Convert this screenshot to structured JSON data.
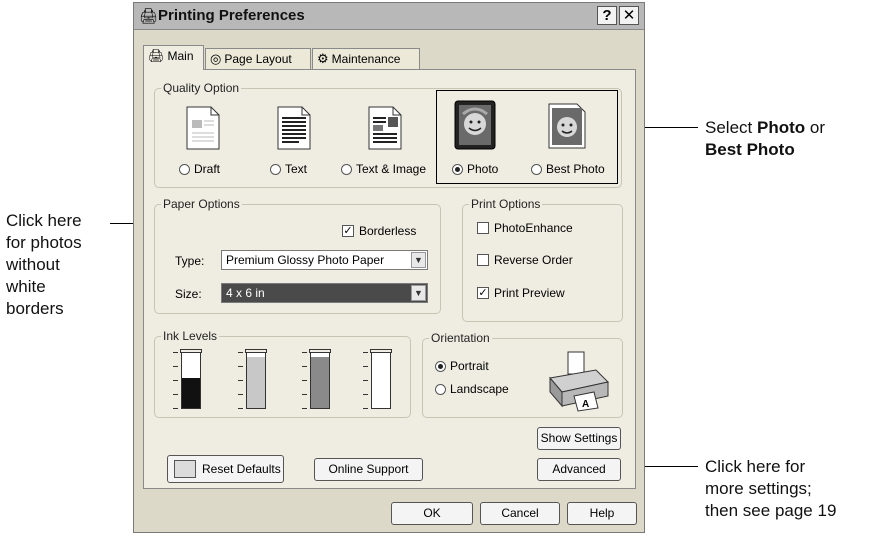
{
  "window": {
    "title": "Printing Preferences",
    "help_btn": "?",
    "close_btn": "✕"
  },
  "tabs": [
    {
      "label": "Main",
      "icon": "printer-icon"
    },
    {
      "label": "Page Layout",
      "icon": "page-layout-icon"
    },
    {
      "label": "Maintenance",
      "icon": "maintenance-icon"
    }
  ],
  "quality": {
    "group_label": "Quality Option",
    "options": [
      {
        "label": "Draft",
        "selected": false
      },
      {
        "label": "Text",
        "selected": false
      },
      {
        "label": "Text & Image",
        "selected": false
      },
      {
        "label": "Photo",
        "selected": true
      },
      {
        "label": "Best Photo",
        "selected": false
      }
    ]
  },
  "paper": {
    "group_label": "Paper Options",
    "borderless_label": "Borderless",
    "borderless_checked": true,
    "type_label": "Type:",
    "type_value": "Premium Glossy Photo Paper",
    "size_label": "Size:",
    "size_value": "4 x 6 in"
  },
  "print_options": {
    "group_label": "Print Options",
    "items": [
      {
        "label": "PhotoEnhance",
        "checked": false
      },
      {
        "label": "Reverse Order",
        "checked": false
      },
      {
        "label": "Print Preview",
        "checked": true
      }
    ]
  },
  "ink": {
    "group_label": "Ink Levels",
    "tanks": [
      {
        "level": 0.55,
        "color": "#111111"
      },
      {
        "level": 0.92,
        "color": "#c8c8c8"
      },
      {
        "level": 0.92,
        "color": "#8a8a8a"
      },
      {
        "level": 0.0,
        "color": "#ffffff"
      }
    ]
  },
  "orientation": {
    "group_label": "Orientation",
    "portrait_label": "Portrait",
    "landscape_label": "Landscape",
    "portrait_selected": true
  },
  "buttons": {
    "show_settings": "Show Settings",
    "reset_defaults": "Reset Defaults",
    "online_support": "Online Support",
    "advanced": "Advanced",
    "ok": "OK",
    "cancel": "Cancel",
    "help": "Help"
  },
  "annotations": {
    "left_lines": [
      "Click here",
      "for photos",
      "without",
      "white",
      "borders"
    ],
    "select_pre": "Select ",
    "select_photo": "Photo",
    "select_or": " or",
    "select_best": "Best Photo",
    "advanced_lines": [
      "Click here for",
      "more settings;",
      "then see page 19"
    ]
  }
}
